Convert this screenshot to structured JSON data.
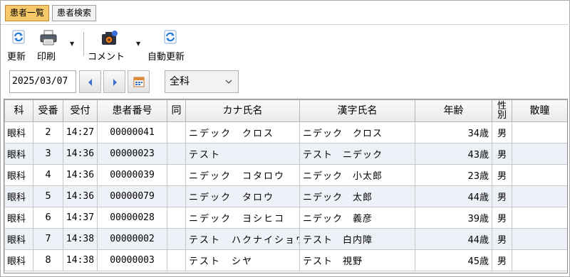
{
  "tabs": [
    {
      "label": "患者一覧",
      "active": true
    },
    {
      "label": "患者検索",
      "active": false
    }
  ],
  "toolbar": {
    "refresh_label": "更新",
    "print_label": "印刷",
    "comment_label": "コメント",
    "auto_refresh_label": "自動更新"
  },
  "filters": {
    "date": "2025/03/07",
    "department": "全科"
  },
  "table": {
    "headers": {
      "dept": "科",
      "reception_no": "受番",
      "reception_time": "受付",
      "patient_id": "患者番号",
      "same": "同",
      "kana_name": "カナ氏名",
      "kanji_name": "漢字氏名",
      "age": "年齢",
      "sex_top": "性",
      "sex_bottom": "別",
      "extra": "散瞳"
    },
    "rows": [
      {
        "dept": "眼科",
        "no": "2",
        "time": "14:27",
        "id": "00000041",
        "same": "",
        "kana": "ニデック　クロス",
        "kanji": "ニデック　クロス",
        "age": "34歳",
        "sex": "男",
        "extra": ""
      },
      {
        "dept": "眼科",
        "no": "3",
        "time": "14:36",
        "id": "00000023",
        "same": "",
        "kana": "テスト",
        "kanji": "テスト　ニデック",
        "age": "43歳",
        "sex": "男",
        "extra": ""
      },
      {
        "dept": "眼科",
        "no": "4",
        "time": "14:36",
        "id": "00000039",
        "same": "",
        "kana": "ニデック　コタロウ",
        "kanji": "ニデック　小太郎",
        "age": "23歳",
        "sex": "男",
        "extra": ""
      },
      {
        "dept": "眼科",
        "no": "5",
        "time": "14:36",
        "id": "00000079",
        "same": "",
        "kana": "ニデック　タロウ",
        "kanji": "ニデック　太郎",
        "age": "44歳",
        "sex": "男",
        "extra": ""
      },
      {
        "dept": "眼科",
        "no": "6",
        "time": "14:37",
        "id": "00000028",
        "same": "",
        "kana": "ニデック　ヨシヒコ",
        "kanji": "ニデック　義彦",
        "age": "39歳",
        "sex": "男",
        "extra": ""
      },
      {
        "dept": "眼科",
        "no": "7",
        "time": "14:38",
        "id": "00000002",
        "same": "",
        "kana": "テスト　ハクナイショウ",
        "kanji": "テスト　白内障",
        "age": "44歳",
        "sex": "男",
        "extra": ""
      },
      {
        "dept": "眼科",
        "no": "8",
        "time": "14:38",
        "id": "00000003",
        "same": "",
        "kana": "テスト　シヤ",
        "kanji": "テスト　視野",
        "age": "45歳",
        "sex": "男",
        "extra": ""
      }
    ]
  },
  "colors": {
    "active_tab": "#f7c96a",
    "alt_row": "#eef1f8",
    "nav_arrow": "#3a6fcf"
  }
}
